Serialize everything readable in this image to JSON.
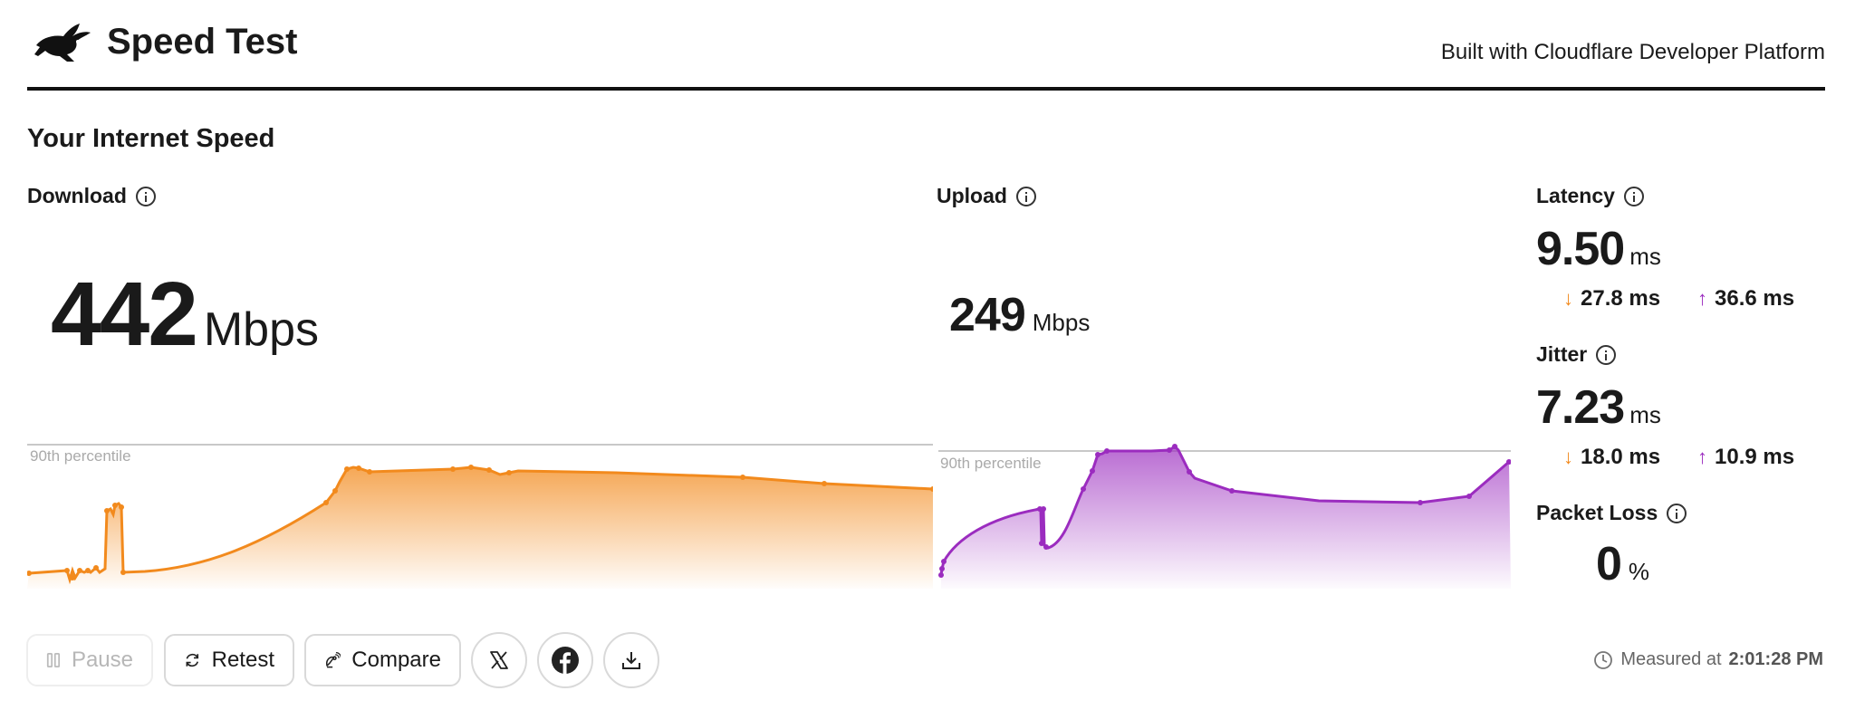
{
  "header": {
    "title": "Speed Test",
    "built_with": "Built with Cloudflare Developer Platform"
  },
  "section_title": "Your Internet Speed",
  "download": {
    "label": "Download",
    "value": "442",
    "unit": "Mbps",
    "percentile_label": "90th percentile",
    "color": "#f28a1d"
  },
  "upload": {
    "label": "Upload",
    "value": "249",
    "unit": "Mbps",
    "percentile_label": "90th percentile",
    "color": "#9b2cbf"
  },
  "latency": {
    "label": "Latency",
    "value": "9.50",
    "unit": "ms",
    "down": "27.8 ms",
    "up": "36.6 ms",
    "down_arrow": "↓",
    "up_arrow": "↑"
  },
  "jitter": {
    "label": "Jitter",
    "value": "7.23",
    "unit": "ms",
    "down": "18.0 ms",
    "up": "10.9 ms",
    "down_arrow": "↓",
    "up_arrow": "↑"
  },
  "packet_loss": {
    "label": "Packet Loss",
    "value": "0",
    "unit": "%"
  },
  "buttons": {
    "pause": "Pause",
    "retest": "Retest",
    "compare": "Compare"
  },
  "measured": {
    "prefix": "Measured at",
    "time": "2:01:28 PM"
  },
  "icons": [
    "rabbit-logo-icon",
    "info-icon",
    "pause-icon",
    "retest-icon",
    "compare-icon",
    "x-icon",
    "facebook-icon",
    "download-icon",
    "clock-icon"
  ]
}
